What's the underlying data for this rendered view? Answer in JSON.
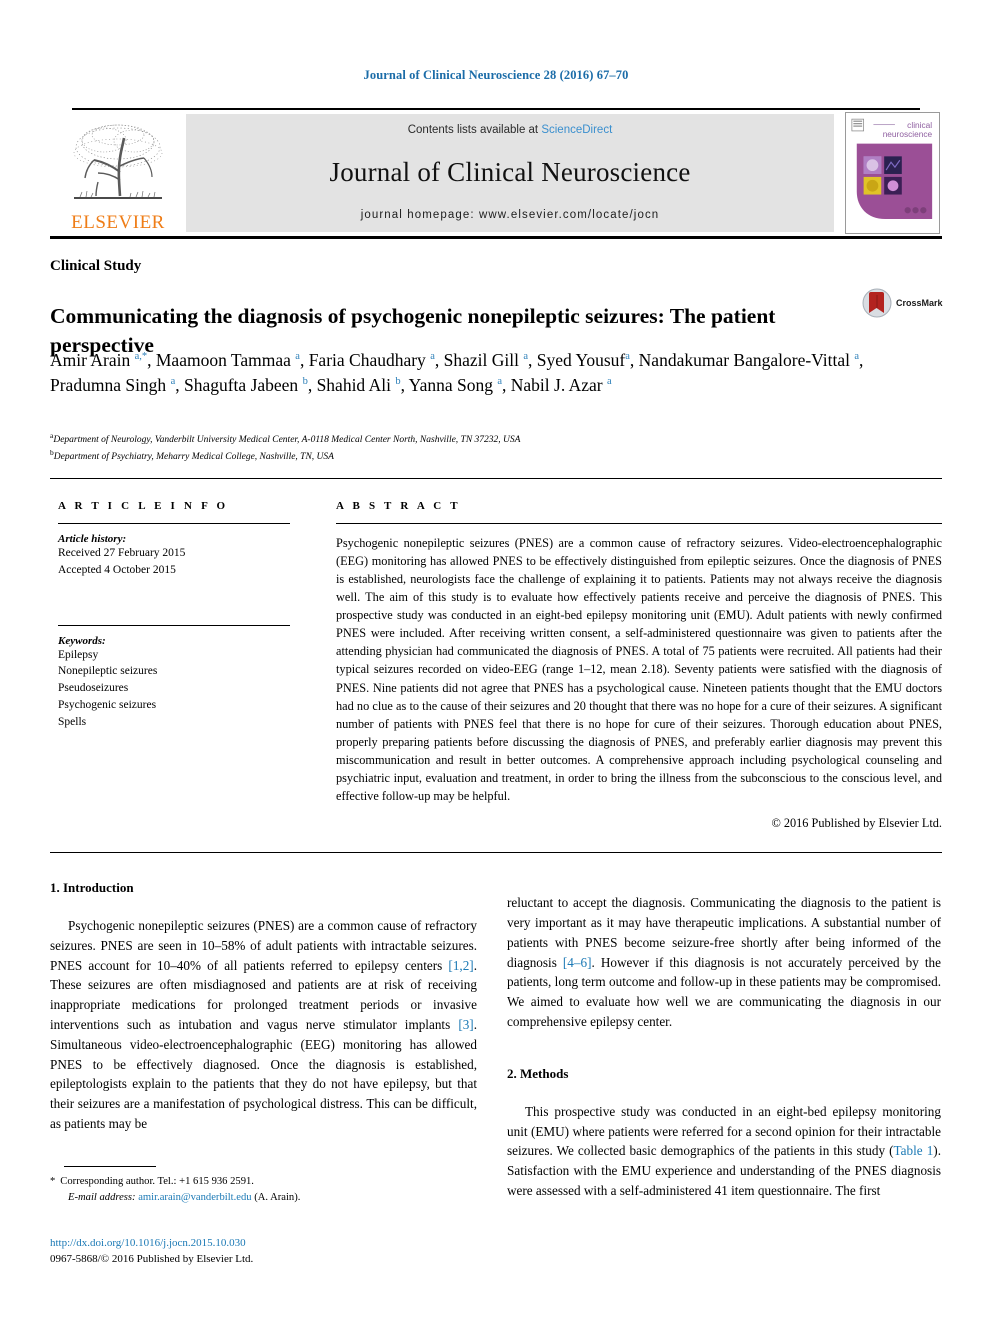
{
  "running_head": "Journal of Clinical Neuroscience 28 (2016) 67–70",
  "header": {
    "elsevier_wordmark": "ELSEVIER",
    "contents_prefix": "Contents lists available at ",
    "contents_link": "ScienceDirect",
    "journal_name": "Journal of Clinical Neuroscience",
    "homepage": "journal homepage: www.elsevier.com/locate/jocn",
    "cover_title_line1": "clinical",
    "cover_title_line2": "neuroscience"
  },
  "article": {
    "type": "Clinical Study",
    "title": "Communicating the diagnosis of psychogenic nonepileptic seizures: The patient perspective",
    "crossmark_label": "CrossMark",
    "authors_html": "Amir Arain <sup>a,*</sup>, Maamoon Tammaa <sup>a</sup>, Faria Chaudhary <sup>a</sup>, Shazil Gill <sup>a</sup>, Syed Yousuf<sup>a</sup>, Nandakumar Bangalore-Vittal <sup>a</sup>, Pradumna Singh <sup>a</sup>, Shagufta Jabeen <sup>b</sup>, Shahid Ali <sup>b</sup>, Yanna Song <sup>a</sup>, Nabil J. Azar <sup>a</sup>",
    "affiliation_a": "Department of Neurology, Vanderbilt University Medical Center, A-0118 Medical Center North, Nashville, TN 37232, USA",
    "affiliation_b": "Department of Psychiatry, Meharry Medical College, Nashville, TN, USA"
  },
  "article_info": {
    "heading": "A R T I C L E   I N F O",
    "history_label": "Article history:",
    "received": "Received 27 February 2015",
    "accepted": "Accepted 4 October 2015",
    "keywords_label": "Keywords:",
    "keywords": [
      "Epilepsy",
      "Nonepileptic seizures",
      "Pseudoseizures",
      "Psychogenic seizures",
      "Spells"
    ]
  },
  "abstract": {
    "heading": "A B S T R A C T",
    "text": "Psychogenic nonepileptic seizures (PNES) are a common cause of refractory seizures. Video-electroencephalographic (EEG) monitoring has allowed PNES to be effectively distinguished from epileptic seizures. Once the diagnosis of PNES is established, neurologists face the challenge of explaining it to patients. Patients may not always receive the diagnosis well. The aim of this study is to evaluate how effectively patients receive and perceive the diagnosis of PNES. This prospective study was conducted in an eight-bed epilepsy monitoring unit (EMU). Adult patients with newly confirmed PNES were included. After receiving written consent, a self-administered questionnaire was given to patients after the attending physician had communicated the diagnosis of PNES. A total of 75 patients were recruited. All patients had their typical seizures recorded on video-EEG (range 1–12, mean 2.18). Seventy patients were satisfied with the diagnosis of PNES. Nine patients did not agree that PNES has a psychological cause. Nineteen patients thought that the EMU doctors had no clue as to the cause of their seizures and 20 thought that there was no hope for a cure of their seizures. A significant number of patients with PNES feel that there is no hope for cure of their seizures. Thorough education about PNES, properly preparing patients before discussing the diagnosis of PNES, and preferably earlier diagnosis may prevent this miscommunication and result in better outcomes. A comprehensive approach including psychological counseling and psychiatric input, evaluation and treatment, in order to bring the illness from the subconscious to the conscious level, and effective follow-up may be helpful.",
    "copyright": "© 2016 Published by Elsevier Ltd."
  },
  "body": {
    "intro_heading": "1. Introduction",
    "intro_p1_part1": "Psychogenic nonepileptic seizures (PNES) are a common cause of refractory seizures. PNES are seen in 10–58% of adult patients with intractable seizures. PNES account for 10–40% of all patients referred to epilepsy centers ",
    "intro_ref_1": "[1,2]",
    "intro_p1_part2": ". These seizures are often misdiagnosed and patients are at risk of receiving inappropriate medications for prolonged treatment periods or invasive interventions such as intubation and vagus nerve stimulator implants ",
    "intro_ref_2": "[3]",
    "intro_p1_part3": ". Simultaneous video-electroencephalographic (EEG) monitoring has allowed PNES to be effectively diagnosed. Once the diagnosis is established, epileptologists explain to the patients that they do not have epilepsy, but that their seizures are a manifestation of psychological distress. This can be difficult, as patients may be ",
    "intro_p1_part4": "reluctant to accept the diagnosis. Communicating the diagnosis to the patient is very important as it may have therapeutic implications. A substantial number of patients with PNES become seizure-free shortly after being informed of the diagnosis ",
    "intro_ref_3": "[4–6]",
    "intro_p1_part5": ". However if this diagnosis is not accurately perceived by the patients, long term outcome and follow-up in these patients may be compromised. We aimed to evaluate how well we are communicating the diagnosis in our comprehensive epilepsy center.",
    "methods_heading": "2. Methods",
    "methods_p1_part1": "This prospective study was conducted in an eight-bed epilepsy monitoring unit (EMU) where patients were referred for a second opinion for their intractable seizures. We collected basic demographics of the patients in this study (",
    "methods_table_link": "Table 1",
    "methods_p1_part2": "). Satisfaction with the EMU experience and understanding of the PNES diagnosis were assessed with a self-administered 41 item questionnaire. The first"
  },
  "footnote": {
    "star": "*",
    "corresponding": "Corresponding author. Tel.: +1 615 936 2591.",
    "email_label": "E-mail address:",
    "email": "amir.arain@vanderbilt.edu",
    "email_suffix": " (A. Arain).",
    "doi": "http://dx.doi.org/10.1016/j.jocn.2015.10.030",
    "issn": "0967-5868/© 2016 Published by Elsevier Ltd."
  },
  "colors": {
    "link_blue": "#1b79b5",
    "sciencedirect_blue": "#3a8fce",
    "elsevier_orange": "#ef7d17",
    "cover_purple": "#9b4f96",
    "crossmark_red": "#b3231f",
    "running_head_blue": "#1b6ca8"
  }
}
